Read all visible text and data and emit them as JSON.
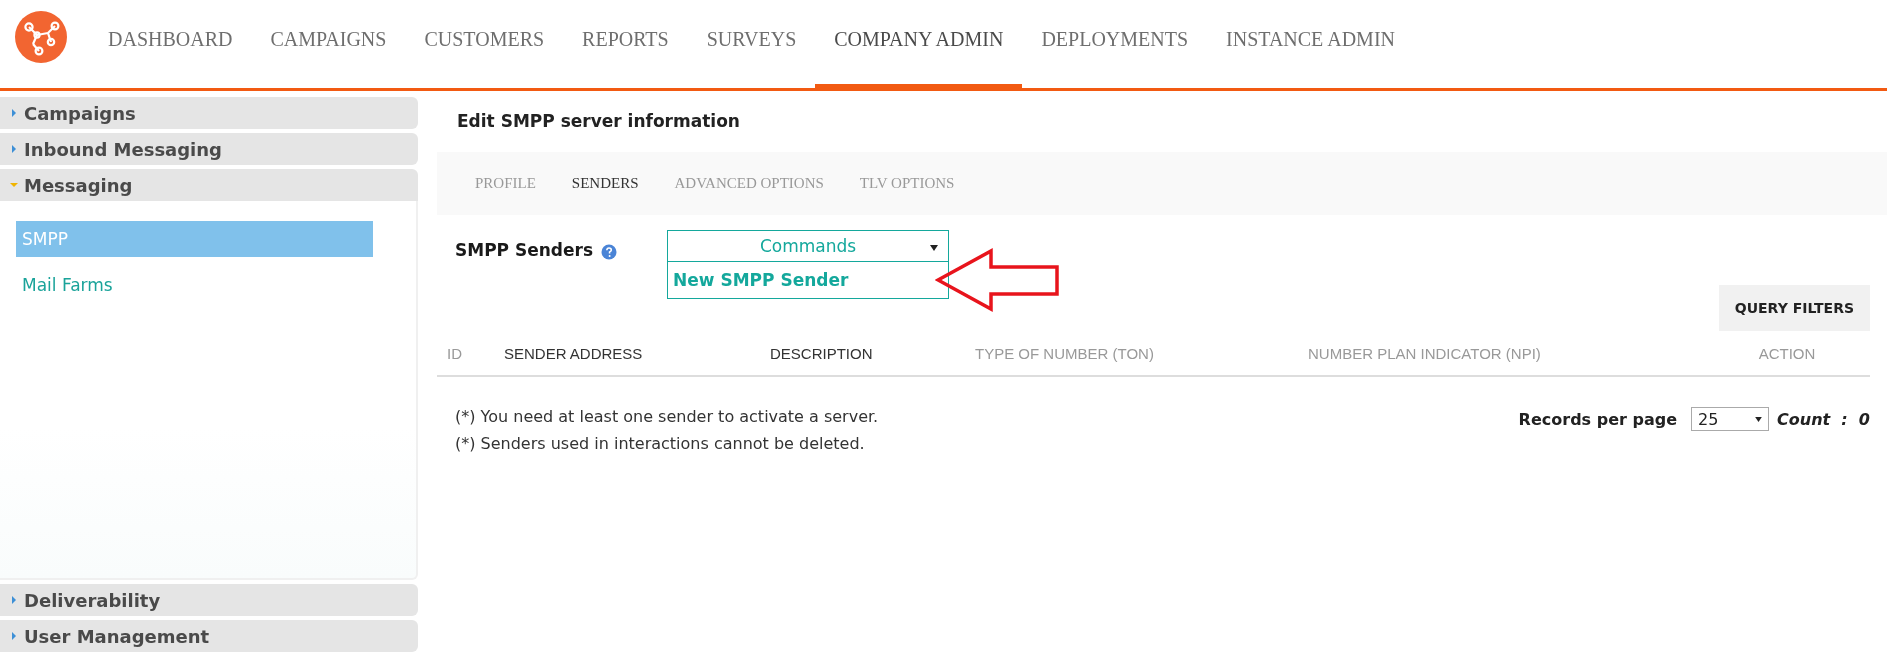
{
  "nav": {
    "items": [
      {
        "label": "DASHBOARD",
        "selected": false
      },
      {
        "label": "CAMPAIGNS",
        "selected": false
      },
      {
        "label": "CUSTOMERS",
        "selected": false
      },
      {
        "label": "REPORTS",
        "selected": false
      },
      {
        "label": "SURVEYS",
        "selected": false
      },
      {
        "label": "COMPANY ADMIN",
        "selected": true
      },
      {
        "label": "DEPLOYMENTS",
        "selected": false
      },
      {
        "label": "INSTANCE ADMIN",
        "selected": false
      }
    ]
  },
  "sidebar": {
    "sections": [
      {
        "label": "Campaigns",
        "expanded": false
      },
      {
        "label": "Inbound Messaging",
        "expanded": false
      },
      {
        "label": "Messaging",
        "expanded": true,
        "children": [
          {
            "label": "SMPP",
            "selected": true
          },
          {
            "label": "Mail Farms",
            "selected": false
          }
        ]
      },
      {
        "label": "Deliverability",
        "expanded": false
      },
      {
        "label": "User Management",
        "expanded": false
      }
    ]
  },
  "main": {
    "title": "Edit SMPP server information",
    "tabs": [
      {
        "label": "PROFILE",
        "selected": false
      },
      {
        "label": "SENDERS",
        "selected": true
      },
      {
        "label": "ADVANCED OPTIONS",
        "selected": false
      },
      {
        "label": "TLV OPTIONS",
        "selected": false
      }
    ],
    "senders_label": "SMPP Senders",
    "commands": {
      "label": "Commands",
      "expanded": true,
      "menu_items": [
        "New SMPP Sender"
      ]
    },
    "query_filters": "QUERY FILTERS",
    "columns": [
      {
        "label": "ID",
        "highlighted": false
      },
      {
        "label": "SENDER ADDRESS",
        "highlighted": true
      },
      {
        "label": "DESCRIPTION",
        "highlighted": true
      },
      {
        "label": "TYPE OF NUMBER (TON)",
        "highlighted": false
      },
      {
        "label": "NUMBER PLAN INDICATOR (NPI)",
        "highlighted": false
      },
      {
        "label": "ACTION",
        "highlighted": false
      }
    ],
    "notes": [
      "(*) You need at least one sender to activate a server.",
      "(*) Senders used in interactions cannot be deleted."
    ],
    "records_per_page": {
      "label": "Records per page",
      "value": "25"
    },
    "count": "Count  :  0"
  }
}
